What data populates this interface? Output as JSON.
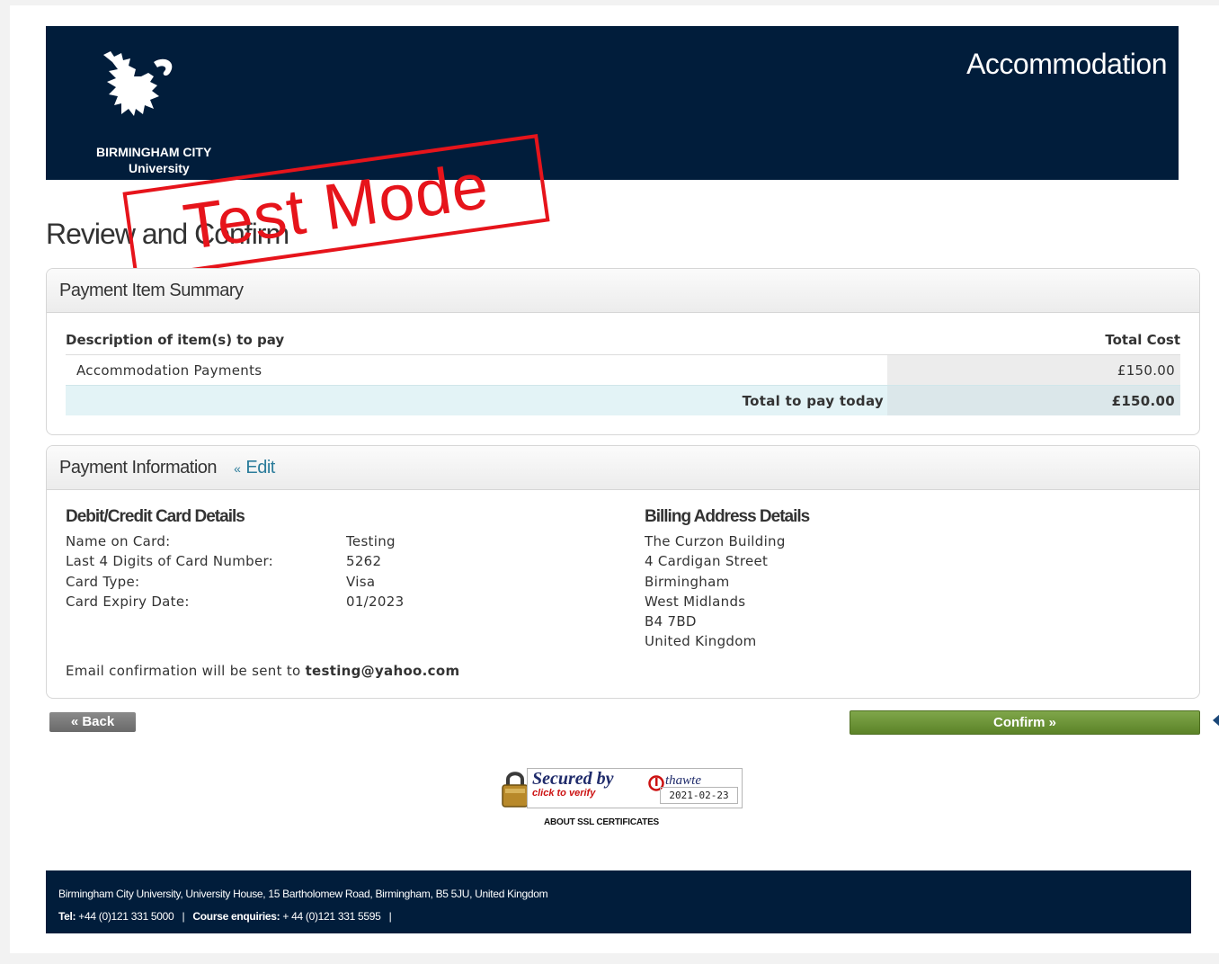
{
  "header": {
    "logo_line1": "BIRMINGHAM CITY",
    "logo_line2": "University",
    "title": "Accommodation"
  },
  "stamp": "Test Mode",
  "page_title": "Review and Confirm",
  "summary": {
    "heading": "Payment Item Summary",
    "col_desc": "Description of item(s) to pay",
    "col_cost": "Total Cost",
    "items": [
      {
        "desc": "Accommodation Payments",
        "cost": "£150.00"
      }
    ],
    "total_label": "Total to pay today",
    "total_value": "£150.00"
  },
  "payment": {
    "heading": "Payment Information",
    "edit_chevron": "«",
    "edit_label": "Edit",
    "card_title": "Debit/Credit Card Details",
    "card_labels": [
      "Name on Card:",
      "Last 4 Digits of Card Number:",
      "Card Type:",
      "Card Expiry Date:"
    ],
    "card_values": [
      "Testing",
      "5262",
      "Visa",
      "01/2023"
    ],
    "billing_title": "Billing Address Details",
    "billing_lines": [
      "The Curzon Building",
      "4 Cardigan Street",
      "Birmingham",
      "West Midlands",
      "B4 7BD",
      "United Kingdom"
    ],
    "email_prefix": "Email confirmation will be sent to",
    "email": "testing@yahoo.com"
  },
  "buttons": {
    "back": "« Back",
    "confirm": "Confirm »"
  },
  "seal": {
    "secured": "Secured by",
    "brand": "thawte",
    "click": "click to verify",
    "date": "2021-02-23",
    "about": "ABOUT SSL CERTIFICATES"
  },
  "footer": {
    "address": "Birmingham City University, University House, 15 Bartholomew Road, Birmingham, B5 5JU, United Kingdom",
    "tel_label": "Tel:",
    "tel": "+44 (0)121 331 5000",
    "sep": "|",
    "course_label": "Course enquiries:",
    "course": "+ 44 (0)121 331 5595"
  },
  "colors": {
    "header_bg": "#011d3b",
    "stamp": "#e6141b",
    "confirm": "#6a9336",
    "link": "#2b7c9b"
  }
}
